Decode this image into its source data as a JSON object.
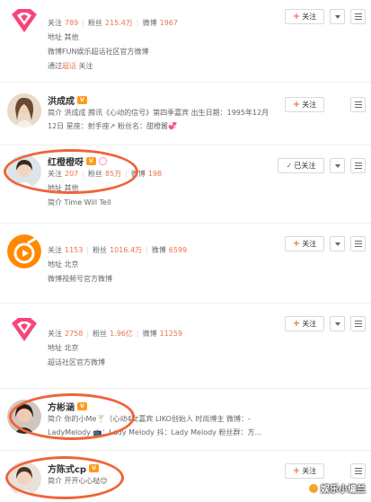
{
  "labels": {
    "follow": "关注",
    "followers": "粉丝",
    "weibo": "微博",
    "location": "地址",
    "intro": "简介",
    "via": "通过",
    "followed": "已关注"
  },
  "users": [
    {
      "name": "",
      "following": "789",
      "fans": "215.4万",
      "weibo_count": "1967",
      "location": "其他",
      "desc": "微博FUN娱乐超话社区官方微博",
      "via_link": "超话",
      "via_suffix": "关注"
    },
    {
      "name": "洪成成",
      "intro": "洪成成 腾讯《心动的信号》第四季嘉宾 出生日期：1995年12月12日 星座：射手座↗ 粉丝名：甜橙酱💞"
    },
    {
      "name": "红橙橙呀",
      "following": "207",
      "fans": "85万",
      "weibo_count": "198",
      "location": "其他",
      "intro": "Time Will Tell"
    },
    {
      "name": "",
      "following": "1153",
      "fans": "1016.4万",
      "weibo_count": "6599",
      "location": "北京",
      "desc": "微博视频号官方微博"
    },
    {
      "name": "",
      "following": "2758",
      "fans": "1.96亿",
      "weibo_count": "11259",
      "location": "北京",
      "desc": "超话社区官方微博"
    },
    {
      "name": "方彬涵",
      "intro": "你的小Me🍸（心动4女嘉宾 LIKO创始人 时尚博主 微博：-LadyMelody 📺：Lady Melody 抖：Lady Melody 粉丝群：方..."
    },
    {
      "name": "方陈式cp",
      "intro": "开开心心哒😊"
    }
  ],
  "watermark": "娱乐小编兰",
  "colors": {
    "accent": "#eb7350",
    "annotation": "#f0643a",
    "verified_badge": "#ff9a1f"
  }
}
